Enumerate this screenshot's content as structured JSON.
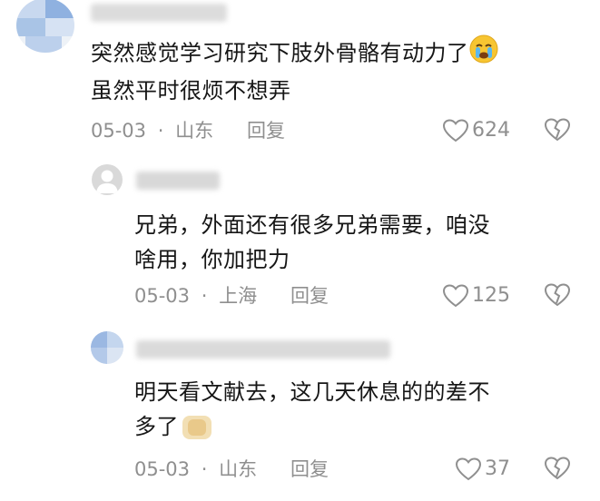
{
  "comments": [
    {
      "text_line1": "突然感觉学习研究下肢外骨骼有动力了",
      "text_line2": "虽然平时很烦不想弄",
      "date": "05-03",
      "location": "山东",
      "reply_label": "回复",
      "likes": "624",
      "avatar_icon": "blurred-avatar",
      "emoji": "crying-face-emoji"
    },
    {
      "text_line1": "兄弟，外面还有很多兄弟需要，咱没",
      "text_line2": "啥用，你加把力",
      "date": "05-03",
      "location": "上海",
      "reply_label": "回复",
      "likes": "125",
      "avatar_icon": "default-gray-avatar"
    },
    {
      "text_line1": "明天看文献去，这几天休息的的差不",
      "text_line2": "多了",
      "date": "05-03",
      "location": "山东",
      "reply_label": "回复",
      "likes": "37",
      "avatar_icon": "blurred-avatar",
      "emoji": "blurred-emoji"
    }
  ],
  "separator": "·",
  "colors": {
    "text": "#161616",
    "meta": "#8f8f8f",
    "blur_blue": "#a9c4e6"
  }
}
